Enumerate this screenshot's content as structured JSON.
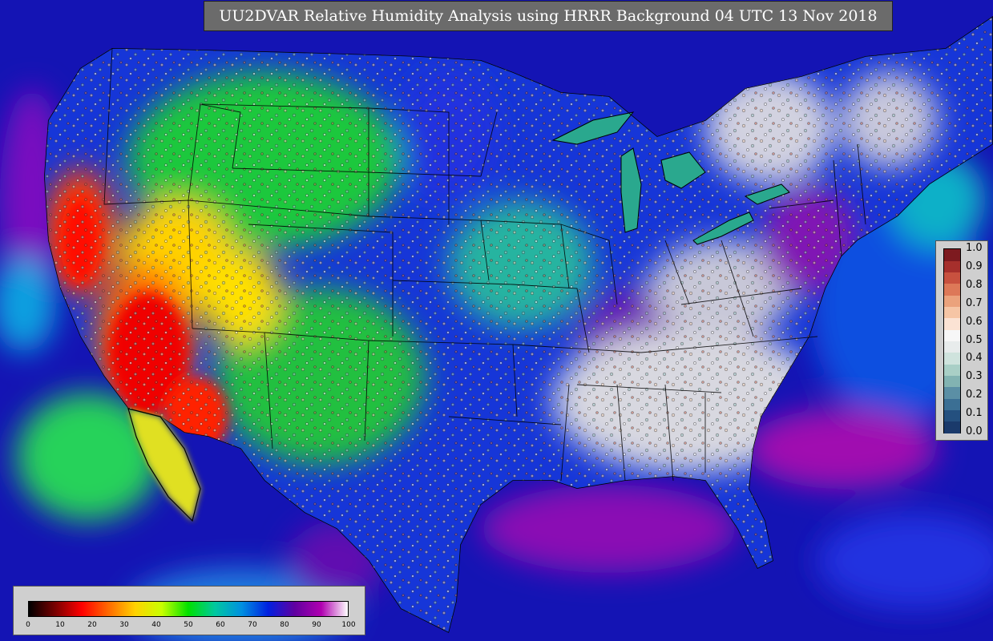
{
  "title": "UU2DVAR Relative Humidity Analysis using HRRR Background 04 UTC 13 Nov 2018",
  "increment_legend": {
    "ticks": [
      "1.0",
      "0.9",
      "0.8",
      "0.7",
      "0.6",
      "0.5",
      "0.4",
      "0.3",
      "0.2",
      "0.1",
      "0.0"
    ],
    "colors": [
      "#1a3a6b",
      "#24507f",
      "#3b6f94",
      "#5b8fa5",
      "#82b3b2",
      "#a9cfc6",
      "#cfe3dd",
      "#e8ecec",
      "#f7f7f7",
      "#fbe3d4",
      "#f6c5a5",
      "#eba27c",
      "#dd7858",
      "#c8513f",
      "#a62f2c",
      "#7d1a1f"
    ]
  },
  "rh_legend": {
    "ticks": [
      "0",
      "10",
      "20",
      "30",
      "40",
      "50",
      "60",
      "70",
      "80",
      "90",
      "100"
    ],
    "stops": [
      "#000000",
      "#7a0000",
      "#ff0000",
      "#ff6a00",
      "#ffd200",
      "#c8ff00",
      "#00e000",
      "#00c8a0",
      "#0090e0",
      "#0020e0",
      "#6000a0",
      "#b000b0",
      "#ffffff"
    ]
  }
}
